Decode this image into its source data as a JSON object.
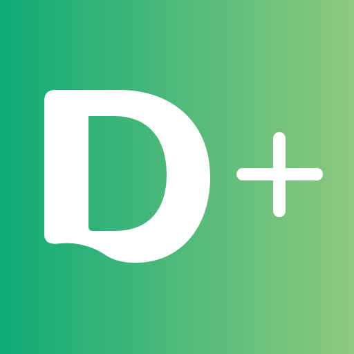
{
  "logo": {
    "name": "D+",
    "icon": "d-plus-logo",
    "colors": {
      "gradient_start": "#0faa77",
      "gradient_end": "#8ec97e",
      "glyph": "#ffffff"
    }
  }
}
